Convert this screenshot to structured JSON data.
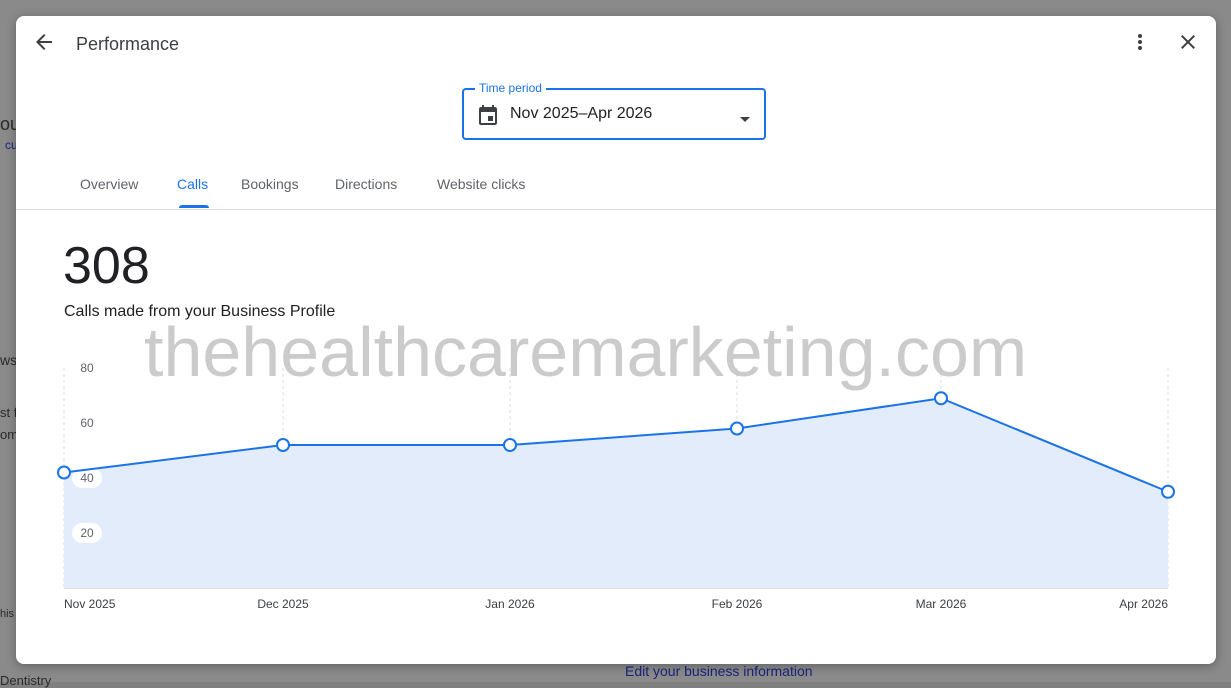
{
  "background": {
    "fragments": [
      "ou",
      "cu",
      "ws",
      "st f",
      "om",
      "his",
      "Dentistry"
    ],
    "link": "Edit your business information"
  },
  "header": {
    "title": "Performance",
    "back_icon": "arrow-back-icon",
    "more_icon": "more-vert-icon",
    "close_icon": "close-icon"
  },
  "time_period": {
    "label": "Time period",
    "value": "Nov 2025–Apr 2026",
    "icon": "calendar-icon"
  },
  "tabs": [
    {
      "label": "Overview",
      "active": false
    },
    {
      "label": "Calls",
      "active": true
    },
    {
      "label": "Bookings",
      "active": false
    },
    {
      "label": "Directions",
      "active": false
    },
    {
      "label": "Website clicks",
      "active": false
    }
  ],
  "summary": {
    "value": "308",
    "caption": "Calls made from your Business Profile"
  },
  "chart_data": {
    "type": "area",
    "x": [
      "Nov 2025",
      "Dec 2025",
      "Jan 2026",
      "Feb 2026",
      "Mar 2026",
      "Apr 2026"
    ],
    "series": [
      {
        "values": [
          42,
          52,
          52,
          58,
          69,
          35
        ]
      }
    ],
    "ylim": [
      0,
      80
    ],
    "yticks": [
      20,
      40,
      60,
      80
    ],
    "grid": "vertical dashed",
    "line_color": "#1a73e8",
    "fill_color": "#e3ecfb"
  },
  "watermark": "thehealthcaremarketing.com",
  "colors": {
    "accent": "#1a73e8"
  }
}
